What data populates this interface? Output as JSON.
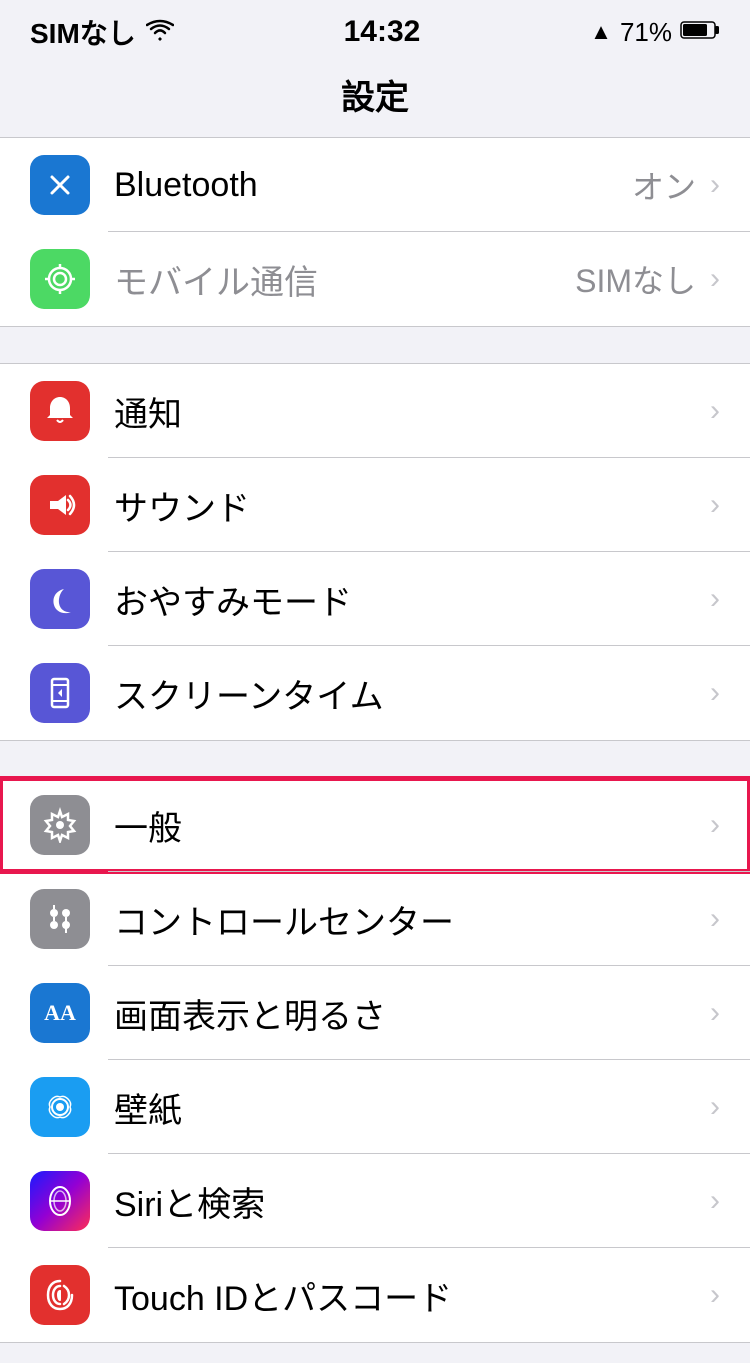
{
  "status_bar": {
    "carrier": "SIMなし",
    "time": "14:32",
    "location_icon": "▲",
    "battery_percent": "71%"
  },
  "page_title": "設定",
  "sections": [
    {
      "id": "connectivity",
      "items": [
        {
          "id": "bluetooth",
          "label": "Bluetooth",
          "value": "オン",
          "icon_color": "bluetooth",
          "icon_type": "bluetooth",
          "disabled": false,
          "highlighted": false
        },
        {
          "id": "cellular",
          "label": "モバイル通信",
          "value": "SIMなし",
          "icon_color": "cellular",
          "icon_type": "cellular",
          "disabled": true,
          "highlighted": false
        }
      ]
    },
    {
      "id": "notifications",
      "items": [
        {
          "id": "notifications",
          "label": "通知",
          "value": "",
          "icon_color": "notifications",
          "icon_type": "notification",
          "disabled": false,
          "highlighted": false
        },
        {
          "id": "sounds",
          "label": "サウンド",
          "value": "",
          "icon_color": "sounds",
          "icon_type": "sound",
          "disabled": false,
          "highlighted": false
        },
        {
          "id": "dnd",
          "label": "おやすみモード",
          "value": "",
          "icon_color": "dnd",
          "icon_type": "moon",
          "disabled": false,
          "highlighted": false
        },
        {
          "id": "screentime",
          "label": "スクリーンタイム",
          "value": "",
          "icon_color": "screentime",
          "icon_type": "hourglass",
          "disabled": false,
          "highlighted": false
        }
      ]
    },
    {
      "id": "general",
      "items": [
        {
          "id": "general",
          "label": "一般",
          "value": "",
          "icon_color": "general",
          "icon_type": "gear",
          "disabled": false,
          "highlighted": true
        },
        {
          "id": "controlcenter",
          "label": "コントロールセンター",
          "value": "",
          "icon_color": "controlcenter",
          "icon_type": "sliders",
          "disabled": false,
          "highlighted": false
        },
        {
          "id": "display",
          "label": "画面表示と明るさ",
          "value": "",
          "icon_color": "display",
          "icon_type": "aa",
          "disabled": false,
          "highlighted": false
        },
        {
          "id": "wallpaper",
          "label": "壁紙",
          "value": "",
          "icon_color": "wallpaper",
          "icon_type": "flower",
          "disabled": false,
          "highlighted": false
        },
        {
          "id": "siri",
          "label": "Siriと検索",
          "value": "",
          "icon_color": "siri",
          "icon_type": "siri",
          "disabled": false,
          "highlighted": false
        },
        {
          "id": "touchid",
          "label": "Touch IDとパスコード",
          "value": "",
          "icon_color": "touchid",
          "icon_type": "fingerprint",
          "disabled": false,
          "highlighted": false
        }
      ]
    }
  ]
}
